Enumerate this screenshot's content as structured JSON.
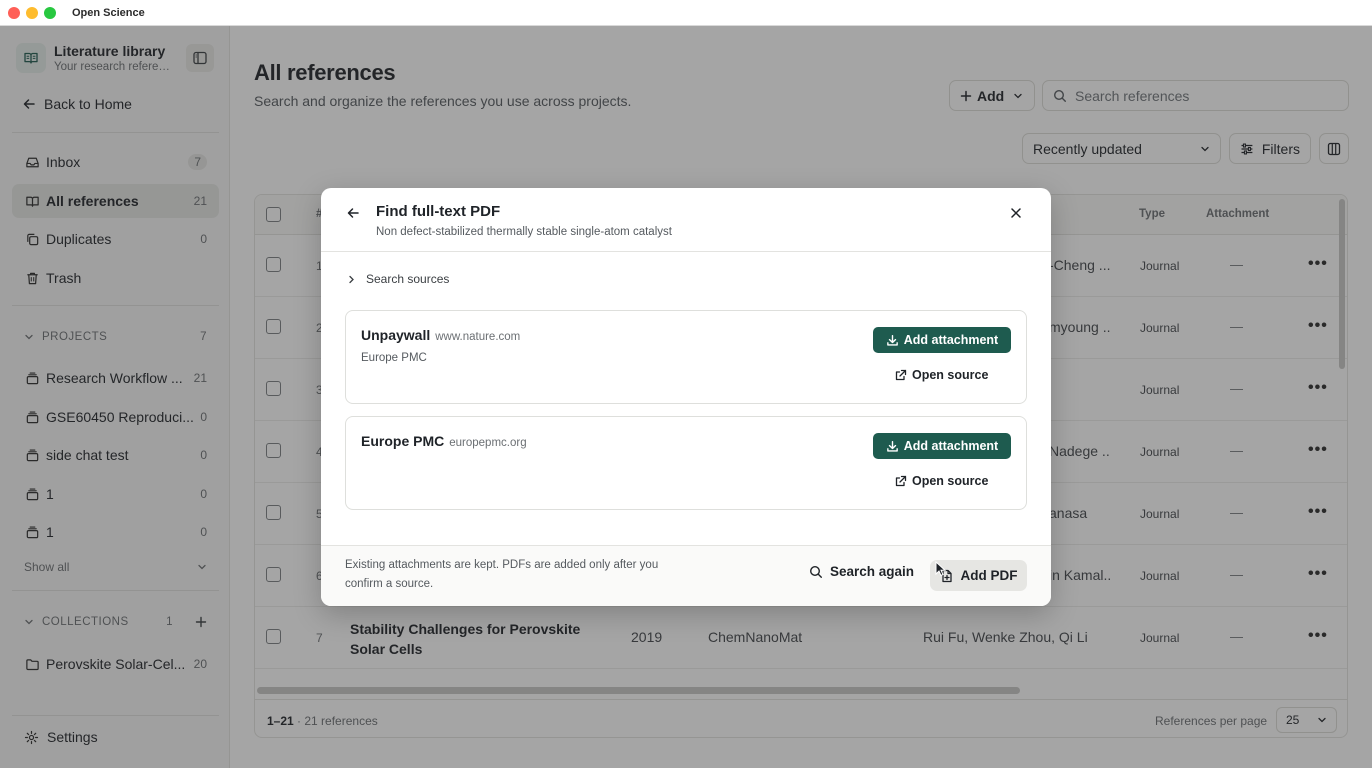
{
  "app": {
    "name": "Open Science"
  },
  "window_lights": [
    "#ff5f57",
    "#febc2e",
    "#28c840"
  ],
  "sidebar": {
    "library_title": "Literature library",
    "library_subtitle": "Your research references",
    "back_home": "Back to Home",
    "nav": [
      {
        "label": "Inbox",
        "count": "7"
      },
      {
        "label": "All references",
        "count": "21"
      },
      {
        "label": "Duplicates",
        "count": "0"
      },
      {
        "label": "Trash",
        "count": ""
      }
    ],
    "projects_header": "PROJECTS",
    "projects_count": "7",
    "projects": [
      {
        "label": "Research Workflow ...",
        "count": "21"
      },
      {
        "label": "GSE60450 Reproduci...",
        "count": "0"
      },
      {
        "label": "side chat test",
        "count": "0"
      },
      {
        "label": "1",
        "count": "0"
      },
      {
        "label": "1",
        "count": "0"
      }
    ],
    "show_all": "Show all",
    "collections_header": "COLLECTIONS",
    "collections_count": "1",
    "collections": [
      {
        "label": "Perovskite Solar-Cel...",
        "count": "20"
      }
    ],
    "settings": "Settings"
  },
  "main": {
    "title": "All references",
    "subtitle": "Search and organize the references you use across projects.",
    "add_label": "Add",
    "search_placeholder": "Search references",
    "sort_value": "Recently updated",
    "filters_label": "Filters",
    "table": {
      "headers": {
        "num": "#",
        "type": "Type",
        "attachment": "Attachment"
      },
      "rows": [
        {
          "num": "1",
          "authors": "-Cheng ...",
          "type": "Journal",
          "attachment": "—"
        },
        {
          "num": "2",
          "authors": "myoung ...",
          "type": "Journal",
          "attachment": "—"
        },
        {
          "num": "3",
          "authors": "",
          "type": "Journal",
          "attachment": "—"
        },
        {
          "num": "4",
          "authors": "Nadege ...",
          "type": "Journal",
          "attachment": "—"
        },
        {
          "num": "5",
          "authors": "anasa",
          "type": "Journal",
          "attachment": "—"
        },
        {
          "num": "6",
          "authors": "in Kamal...",
          "type": "Journal",
          "attachment": "—"
        }
      ],
      "last_row": {
        "num": "7",
        "title": "Stability Challenges for Perovskite Solar Cells",
        "year": "2019",
        "venue": "ChemNanoMat",
        "authors": "Rui Fu, Wenke Zhou, Qi Li",
        "type": "Journal",
        "attachment": "—"
      },
      "range": "1–21",
      "range_suffix": " · 21 references",
      "per_page_label": "References per page",
      "per_page_value": "25"
    }
  },
  "dialog": {
    "title": "Find full-text PDF",
    "subtitle": "Non defect-stabilized thermally stable single-atom catalyst",
    "search_sources": "Search sources",
    "sources": [
      {
        "name": "Unpaywall",
        "domain": "www.nature.com",
        "note": "Europe PMC",
        "add_label": "Add attachment",
        "open_label": "Open source"
      },
      {
        "name": "Europe PMC",
        "domain": "europepmc.org",
        "note": "",
        "add_label": "Add attachment",
        "open_label": "Open source"
      }
    ],
    "footer_note": "Existing attachments are kept. PDFs are added only after you confirm a source.",
    "search_again": "Search again",
    "add_pdf": "Add PDF"
  },
  "colors": {
    "primary": "#1e5b4f",
    "overlay": "rgba(40,40,40,0.42)"
  }
}
